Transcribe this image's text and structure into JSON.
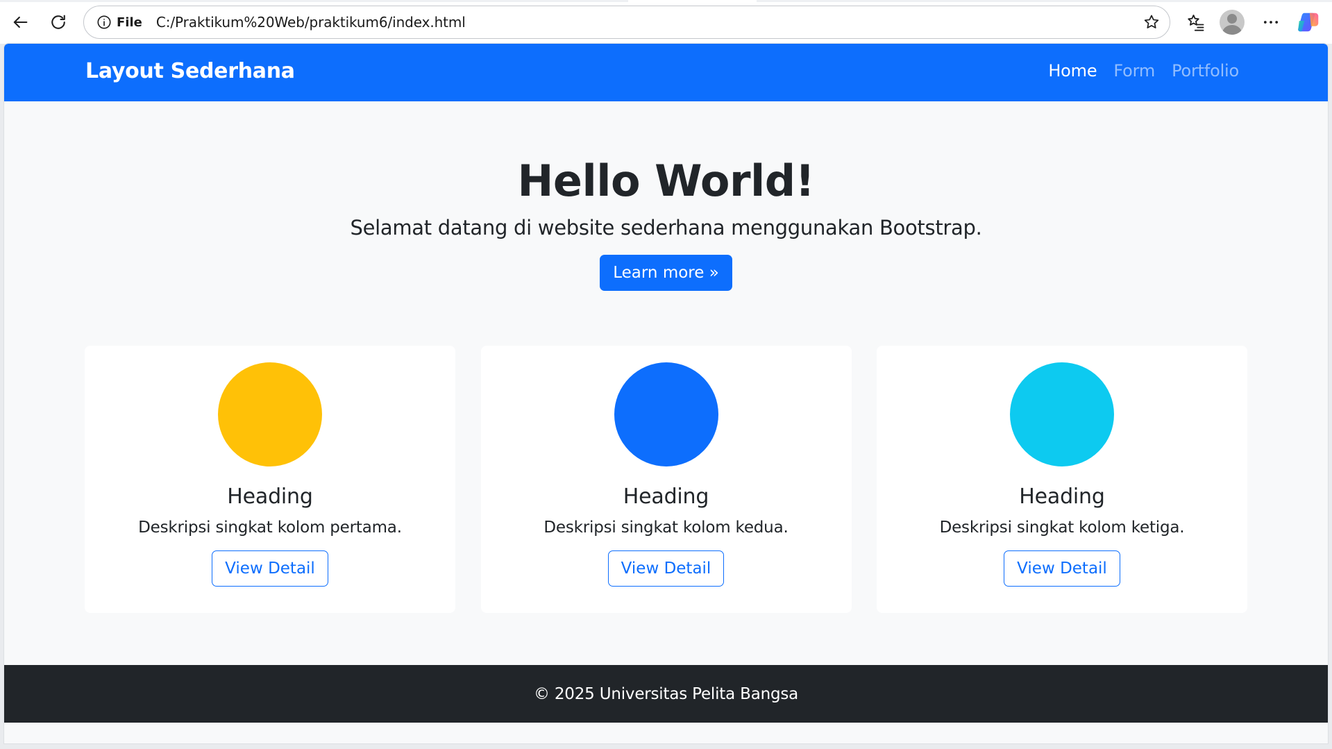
{
  "browser": {
    "site_info_label": "File",
    "url": "C:/Praktikum%20Web/praktikum6/index.html"
  },
  "navbar": {
    "brand": "Layout Sederhana",
    "links": [
      {
        "label": "Home",
        "active": true
      },
      {
        "label": "Form",
        "active": false
      },
      {
        "label": "Portfolio",
        "active": false
      }
    ]
  },
  "hero": {
    "title": "Hello World!",
    "lead": "Selamat datang di website sederhana menggunakan Bootstrap.",
    "button_label": "Learn more »"
  },
  "cards": [
    {
      "title": "Heading",
      "description": "Deskripsi singkat kolom pertama.",
      "button_label": "View Detail",
      "circle_color": "#ffc107"
    },
    {
      "title": "Heading",
      "description": "Deskripsi singkat kolom kedua.",
      "button_label": "View Detail",
      "circle_color": "#0d6efd"
    },
    {
      "title": "Heading",
      "description": "Deskripsi singkat kolom ketiga.",
      "button_label": "View Detail",
      "circle_color": "#0dcaf0"
    }
  ],
  "footer": {
    "text": "© 2025 Universitas Pelita Bangsa"
  },
  "colors": {
    "primary": "#0d6efd",
    "dark": "#212529",
    "light_bg": "#f8f9fa"
  },
  "icons": {
    "back": "back-arrow-icon",
    "reload": "reload-icon",
    "info": "info-icon",
    "favorite": "star-icon",
    "favorites_list": "favorites-icon",
    "profile": "profile-icon",
    "menu": "more-icon",
    "copilot": "copilot-icon"
  }
}
